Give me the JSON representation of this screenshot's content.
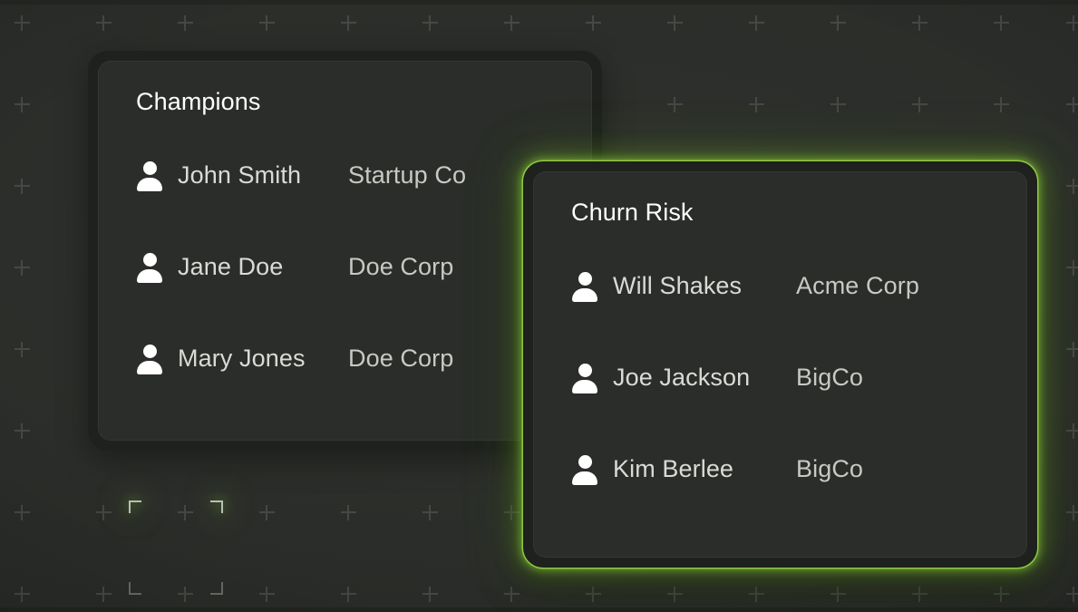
{
  "theme": {
    "background": "#2a2c29",
    "card_frame": "#1e211d",
    "card_surface": "#2a2d29",
    "accent_glow": "#8acc38",
    "title_color": "#ffffff",
    "row_text_color": "#d8dbd6"
  },
  "background_decor": {
    "plus_marks": {
      "icon": "plus-icon",
      "columns": [
        24,
        114,
        204,
        294,
        384,
        474,
        564,
        654,
        744,
        834,
        924,
        1014,
        1104,
        1184
      ],
      "rows": [
        25,
        115,
        205,
        295,
        385,
        475,
        565,
        655
      ]
    },
    "selection_frame": {
      "icon": "selection-brackets-icon",
      "corners": [
        "top-left",
        "top-right",
        "bottom-left",
        "bottom-right"
      ],
      "highlighted_corners": [
        "top-left",
        "top-right"
      ]
    }
  },
  "cards": [
    {
      "id": "champions",
      "title": "Champions",
      "highlighted": false,
      "rows": [
        {
          "icon": "person-icon",
          "name": "John Smith",
          "company": "Startup Co"
        },
        {
          "icon": "person-icon",
          "name": "Jane Doe",
          "company": "Doe Corp"
        },
        {
          "icon": "person-icon",
          "name": "Mary Jones",
          "company": "Doe Corp"
        }
      ]
    },
    {
      "id": "churn-risk",
      "title": "Churn Risk",
      "highlighted": true,
      "rows": [
        {
          "icon": "person-icon",
          "name": "Will Shakes",
          "company": "Acme Corp"
        },
        {
          "icon": "person-icon",
          "name": "Joe Jackson",
          "company": "BigCo"
        },
        {
          "icon": "person-icon",
          "name": "Kim Berlee",
          "company": "BigCo"
        }
      ]
    }
  ]
}
